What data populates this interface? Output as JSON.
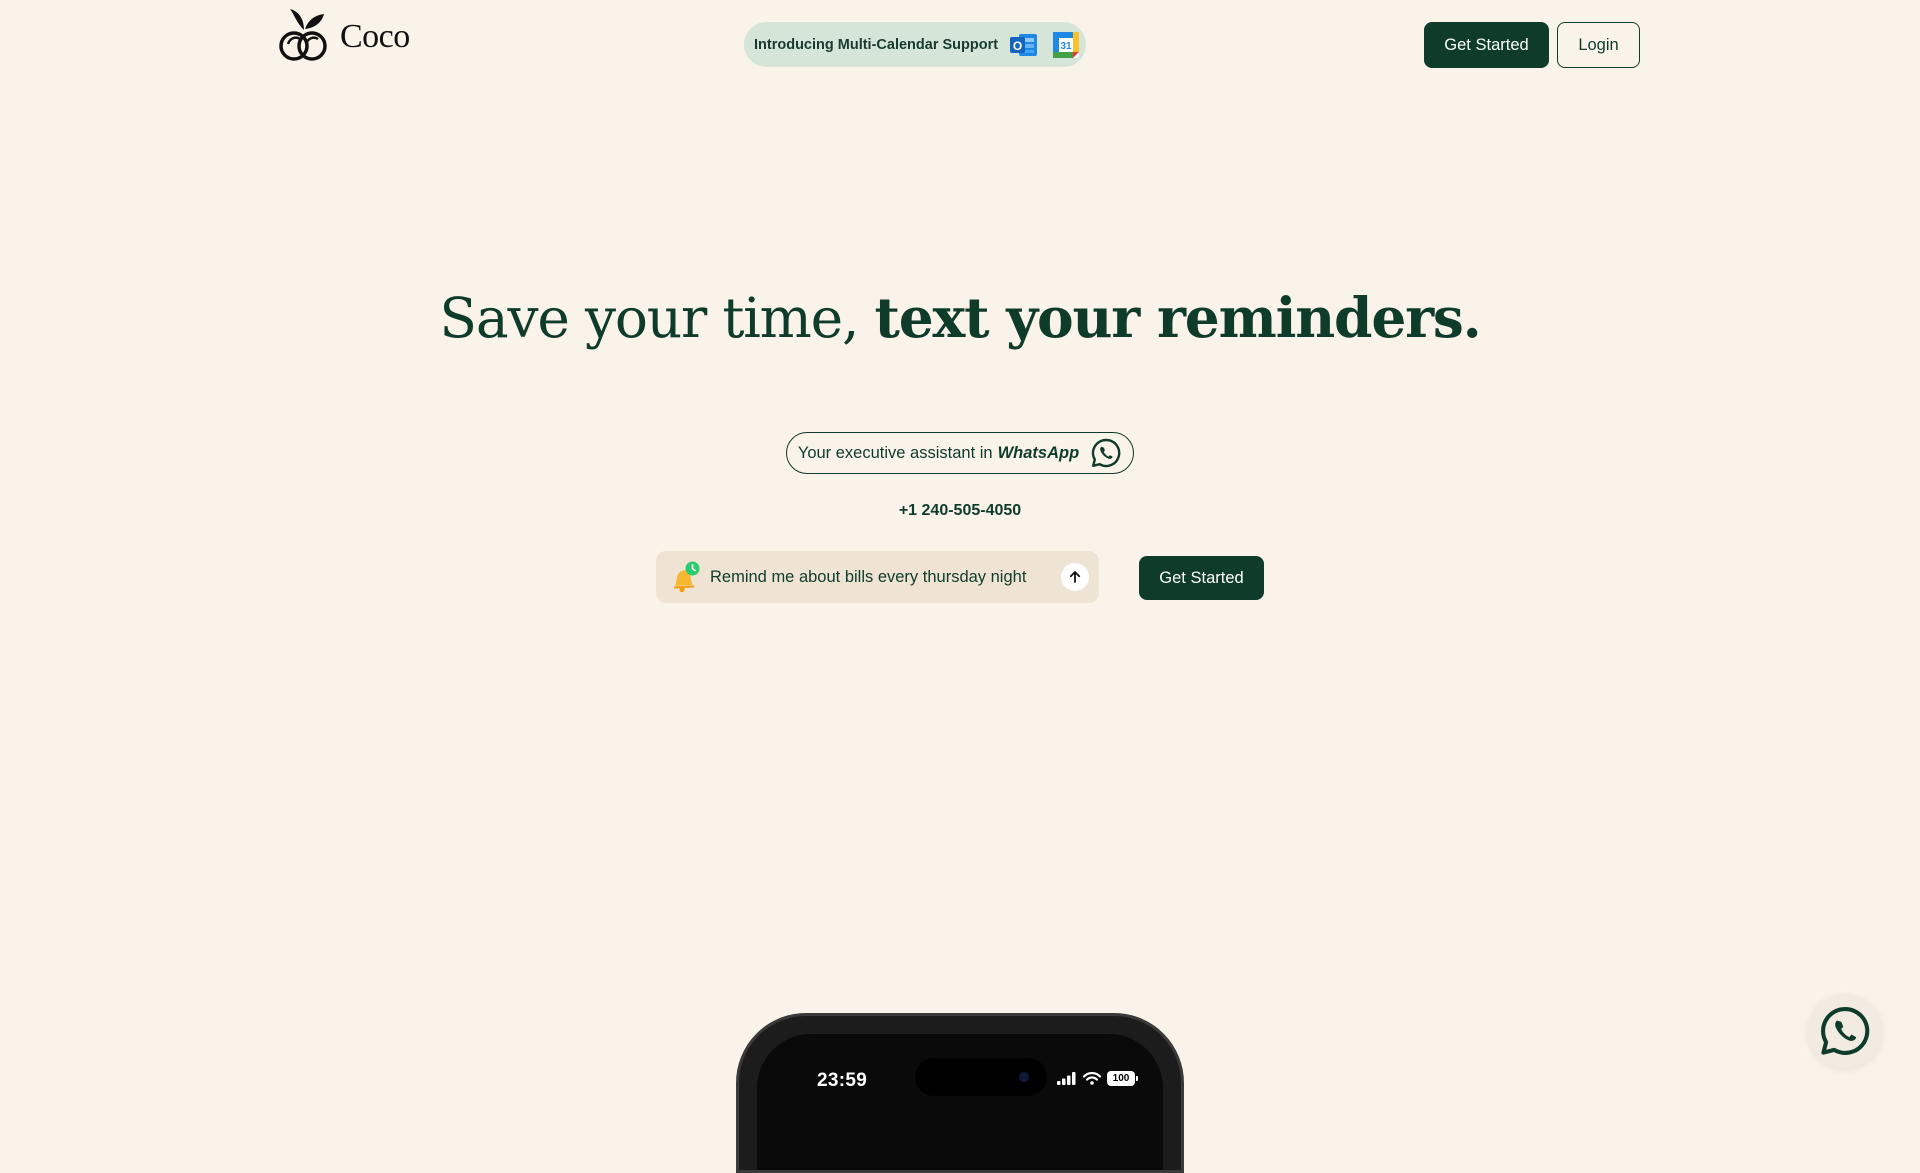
{
  "brand": {
    "name": "Coco",
    "logo_icon": "leaf-logo-icon"
  },
  "announcement": {
    "text": "Introducing Multi-Calendar Support",
    "icons": [
      "outlook-calendar-icon",
      "google-calendar-icon"
    ],
    "google_calendar_day": "31",
    "outlook_letter": "O"
  },
  "nav": {
    "get_started_label": "Get Started",
    "login_label": "Login"
  },
  "hero": {
    "title_regular": "Save your time, ",
    "title_bold": "text your reminders.",
    "assistant_text": "Your executive assistant in ",
    "assistant_highlight": "WhatsApp",
    "assistant_icon": "whatsapp-icon",
    "phone_number": "+1 240-505-4050",
    "prompt_text": "Remind me about bills every thursday night",
    "prompt_icon": "bell-clock-icon",
    "send_icon": "arrow-up-icon",
    "get_started_label": "Get Started"
  },
  "phone_mockup": {
    "time": "23:59",
    "battery": "100",
    "status_icons": [
      "signal-icon",
      "wifi-icon",
      "battery-icon"
    ]
  },
  "floating": {
    "icon": "whatsapp-icon"
  },
  "colors": {
    "background": "#faf3ea",
    "primary": "#0f3b2a",
    "announcement_bg": "#d5e6d9",
    "prompt_bg": "#efe4d4"
  }
}
